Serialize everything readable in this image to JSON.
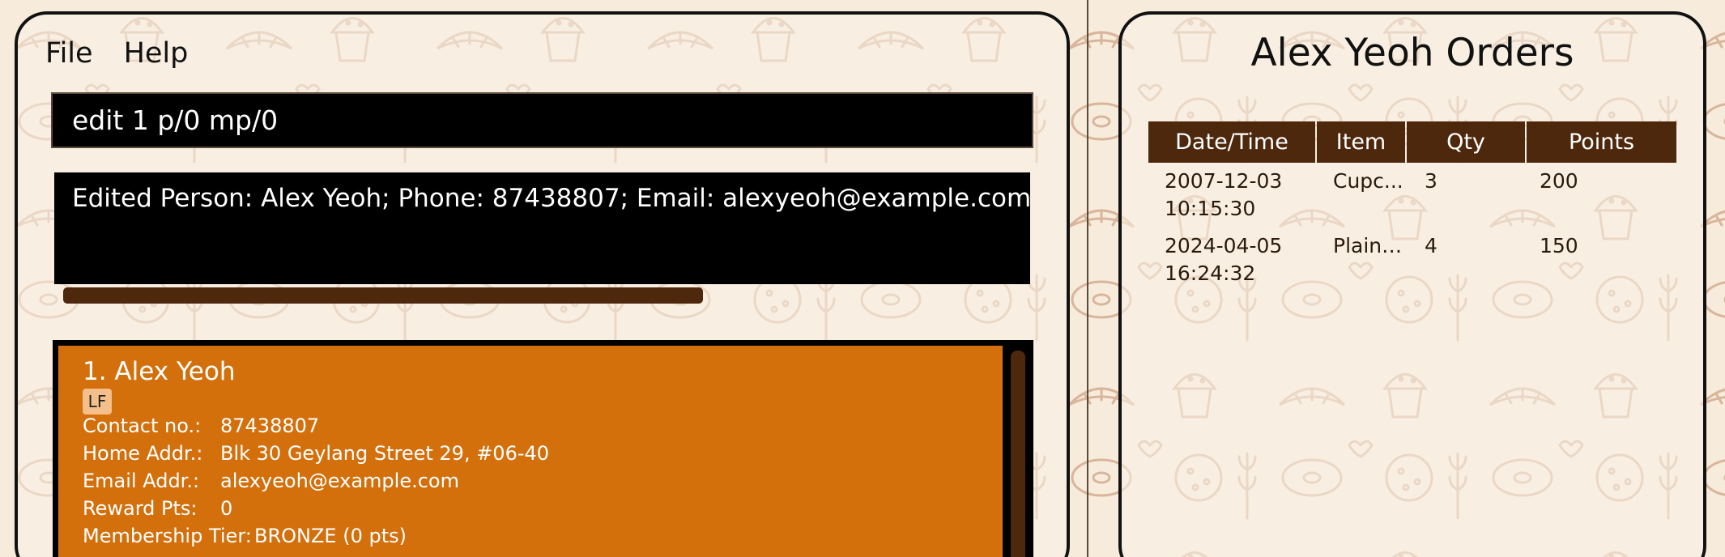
{
  "menu": {
    "file": "File",
    "help": "Help"
  },
  "command": {
    "value": "edit 1 p/0 mp/0"
  },
  "result": {
    "text": "Edited Person: Alex Yeoh; Phone: 87438807; Email: alexyeoh@example.com; Add"
  },
  "person": {
    "index_name": "1.  Alex Yeoh",
    "tag": "LF",
    "fields": [
      {
        "label": "Contact no.:",
        "value": "87438807"
      },
      {
        "label": "Home Addr.:",
        "value": "Blk 30 Geylang Street 29, #06-40"
      },
      {
        "label": "Email Addr.:",
        "value": "alexyeoh@example.com"
      },
      {
        "label": "Reward Pts:",
        "value": "0"
      },
      {
        "label": "Membership Tier:",
        "value": "BRONZE (0 pts)"
      }
    ]
  },
  "orders": {
    "title": "Alex Yeoh Orders",
    "headers": [
      "Date/Time",
      "Item",
      "Qty",
      "Points"
    ],
    "rows": [
      {
        "date": "2007-12-03",
        "time": "10:15:30",
        "item": "Cupc...",
        "qty": "3",
        "points": "200"
      },
      {
        "date": "2024-04-05",
        "time": "16:24:32",
        "item": "Plain ...",
        "qty": "4",
        "points": "150"
      }
    ]
  },
  "colors": {
    "background": "#f7ecdc",
    "accent_brown": "#4d280d",
    "card_orange": "#d3700c",
    "tag_bg": "#f4bf8a"
  },
  "icons": [
    "croissant-icon",
    "muffin-icon",
    "donut-icon",
    "cookie-icon",
    "pretzel-icon",
    "wheat-icon",
    "heart-icon",
    "cake-slice-icon"
  ]
}
